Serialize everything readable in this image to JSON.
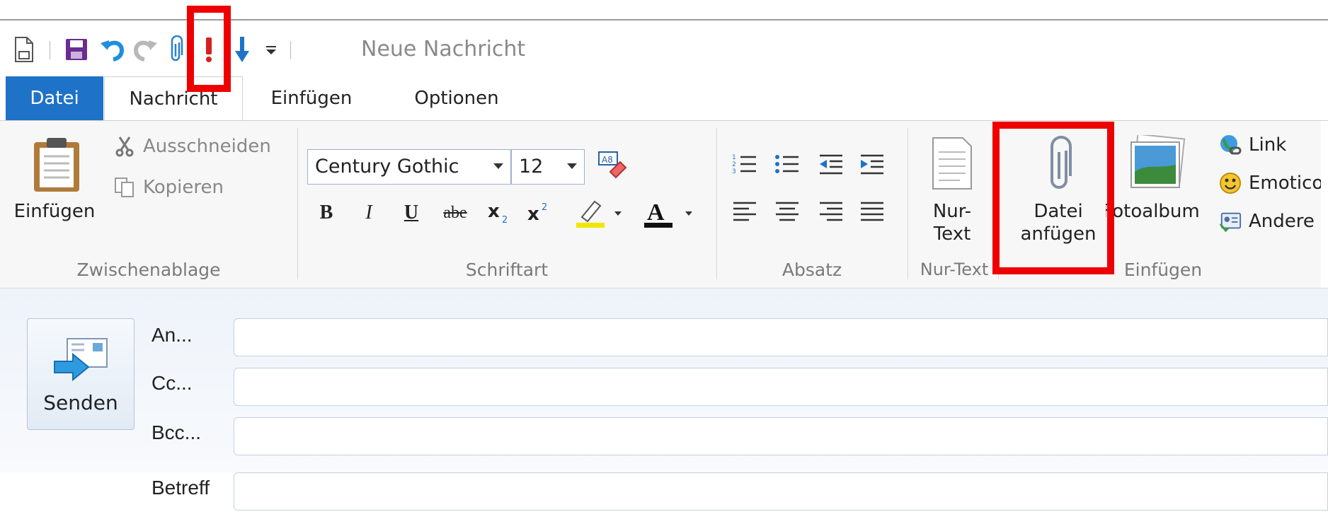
{
  "window_title": "Neue Nachricht",
  "tabs": [
    {
      "label": "Datei"
    },
    {
      "label": "Nachricht"
    },
    {
      "label": "Einfügen"
    },
    {
      "label": "Optionen"
    }
  ],
  "clipboard": {
    "paste_label": "Einfügen",
    "cut_label": "Ausschneiden",
    "copy_label": "Kopieren",
    "group_label": "Zwischenablage"
  },
  "font": {
    "family": "Century Gothic",
    "size": "12",
    "group_label": "Schriftart"
  },
  "paragraph": {
    "group_label": "Absatz"
  },
  "plaintext": {
    "label_line1": "Nur-",
    "label_line2": "Text",
    "group_label": "Nur-Text"
  },
  "insert": {
    "attach_line1": "Datei",
    "attach_line2": "anfügen",
    "photo_album": "Fotoalbum",
    "link": "Link",
    "emoticon": "Emoticon",
    "other": "Andere",
    "group_label": "Einfügen"
  },
  "compose": {
    "send_label": "Senden",
    "to_label": "An...",
    "cc_label": "Cc...",
    "bcc_label": "Bcc...",
    "subject_label": "Betreff"
  },
  "colors": {
    "accent": "#1e72c8",
    "highlight_box": "#ee0000",
    "highlighter_yellow": "#f2e600",
    "font_color_bar": "#111111"
  }
}
